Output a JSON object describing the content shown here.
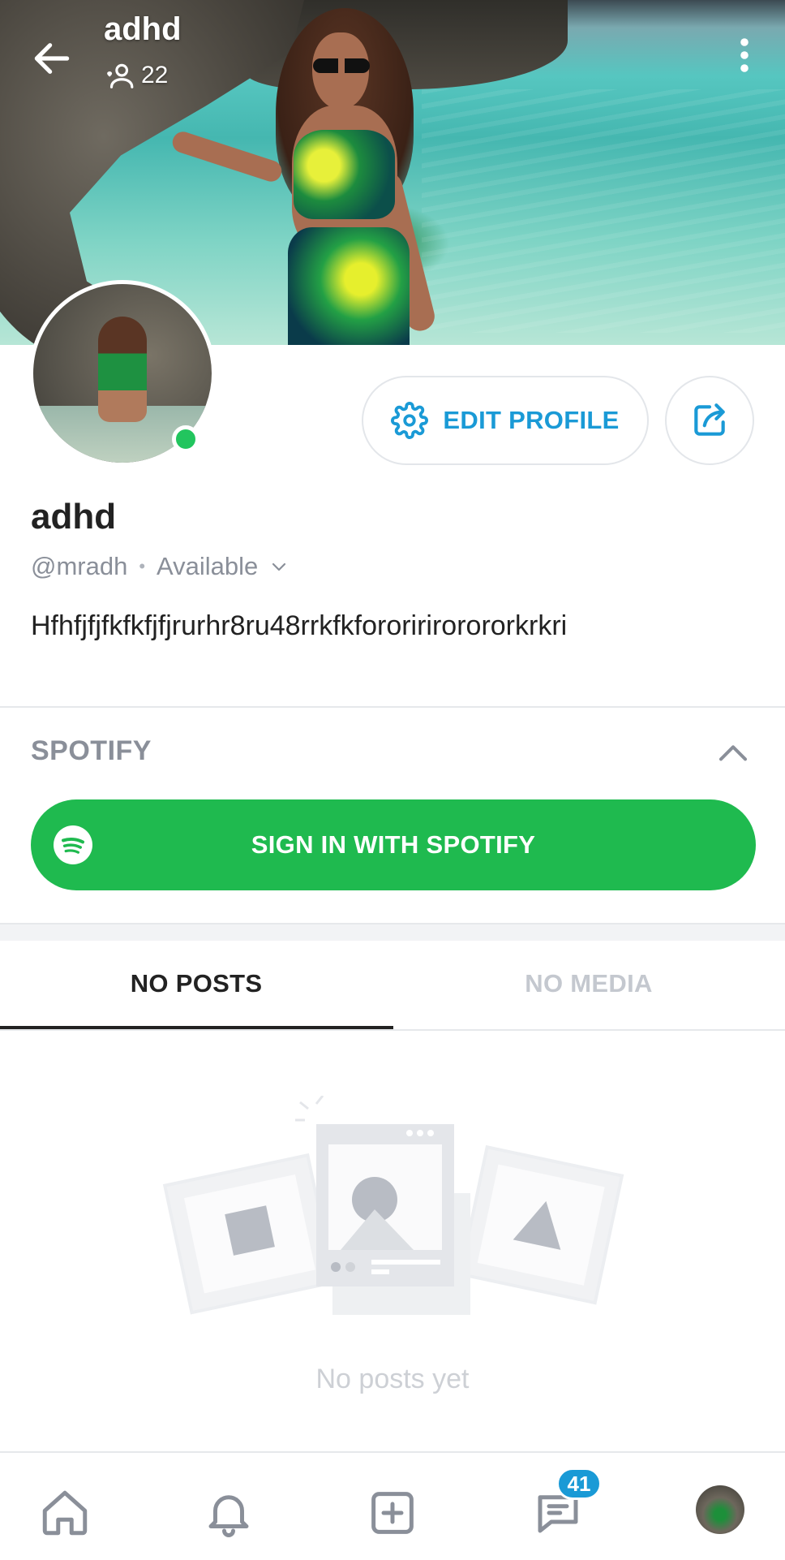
{
  "header": {
    "title": "adhd",
    "followers_count": "22"
  },
  "profile": {
    "display_name": "adhd",
    "handle": "@mradh",
    "separator": "•",
    "status": "Available",
    "bio": "Hfhfjfjfkfkfjfjrurhr8ru48rrkfkfororirirorororkrkri",
    "online": true
  },
  "actions": {
    "edit_profile_label": "EDIT PROFILE"
  },
  "spotify": {
    "section_title": "SPOTIFY",
    "sign_in_label": "SIGN IN WITH SPOTIFY"
  },
  "tabs": [
    {
      "label": "NO POSTS",
      "active": true
    },
    {
      "label": "NO MEDIA",
      "active": false
    }
  ],
  "empty_state": {
    "message": "No posts yet"
  },
  "bottom_nav": {
    "items": [
      "home-icon",
      "bell-icon",
      "add-post-icon",
      "messages-icon",
      "profile-avatar"
    ],
    "messages_badge": "41"
  },
  "colors": {
    "accent": "#1a9ad6",
    "spotify_green": "#1fba4f",
    "online_green": "#22c55e",
    "muted_text": "#8a8f99"
  }
}
